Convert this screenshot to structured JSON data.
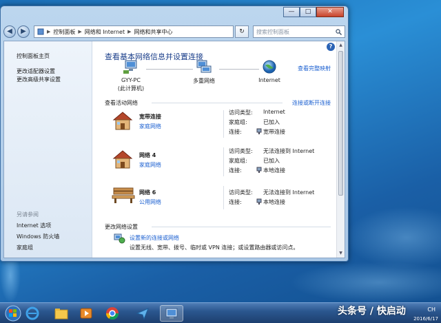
{
  "window": {
    "controls": {
      "minimize": "—",
      "maximize": "□",
      "close": "✕"
    }
  },
  "nav": {
    "back": "◀",
    "forward": "▶",
    "breadcrumbs": [
      "控制面板",
      "网络和 Internet",
      "网络和共享中心"
    ],
    "refresh": "↻",
    "search_placeholder": "搜索控制面板"
  },
  "sidebar": {
    "items": [
      {
        "label": "控制面板主页"
      },
      {
        "label": "更改适配器设置"
      },
      {
        "label": "更改高级共享设置"
      }
    ],
    "see_also": {
      "title": "另请参阅",
      "items": [
        {
          "label": "Internet 选项"
        },
        {
          "label": "Windows 防火墙"
        },
        {
          "label": "家庭组"
        }
      ]
    }
  },
  "main": {
    "heading": "查看基本网络信息并设置连接",
    "full_map_link": "查看完整映射",
    "map": {
      "computer_name": "GYY-PC",
      "computer_sub": "(此计算机)",
      "middle": "多重网络",
      "internet": "Internet"
    },
    "active_title": "查看活动网络",
    "connect_link": "连接或断开连接",
    "networks": [
      {
        "name": "宽带连接",
        "type": "家庭网络",
        "icon": "house-icon",
        "access_label": "访问类型:",
        "access_value": "Internet",
        "homegroup_label": "家庭组:",
        "homegroup_value": "已加入",
        "conn_label": "连接:",
        "conn_value": "宽带连接"
      },
      {
        "name": "网络  4",
        "type": "家庭网络",
        "icon": "house-icon",
        "access_label": "访问类型:",
        "access_value": "无法连接到 Internet",
        "homegroup_label": "家庭组:",
        "homegroup_value": "已加入",
        "conn_label": "连接:",
        "conn_value": "本地连接"
      },
      {
        "name": "网络  6",
        "type": "公用网络",
        "icon": "bench-icon",
        "access_label": "访问类型:",
        "access_value": "无法连接到 Internet",
        "conn_label": "连接:",
        "conn_value": "本地连接"
      }
    ],
    "change_title": "更改网络设置",
    "setup_link": "设置新的连接或网络",
    "setup_desc": "设置无线、宽带、拨号、临时或 VPN 连接；或设置路由器或访问点。"
  },
  "taskbar": {
    "tray_lang": "CH",
    "date": "2016/6/17"
  },
  "watermark": "头条号 / 快启动"
}
